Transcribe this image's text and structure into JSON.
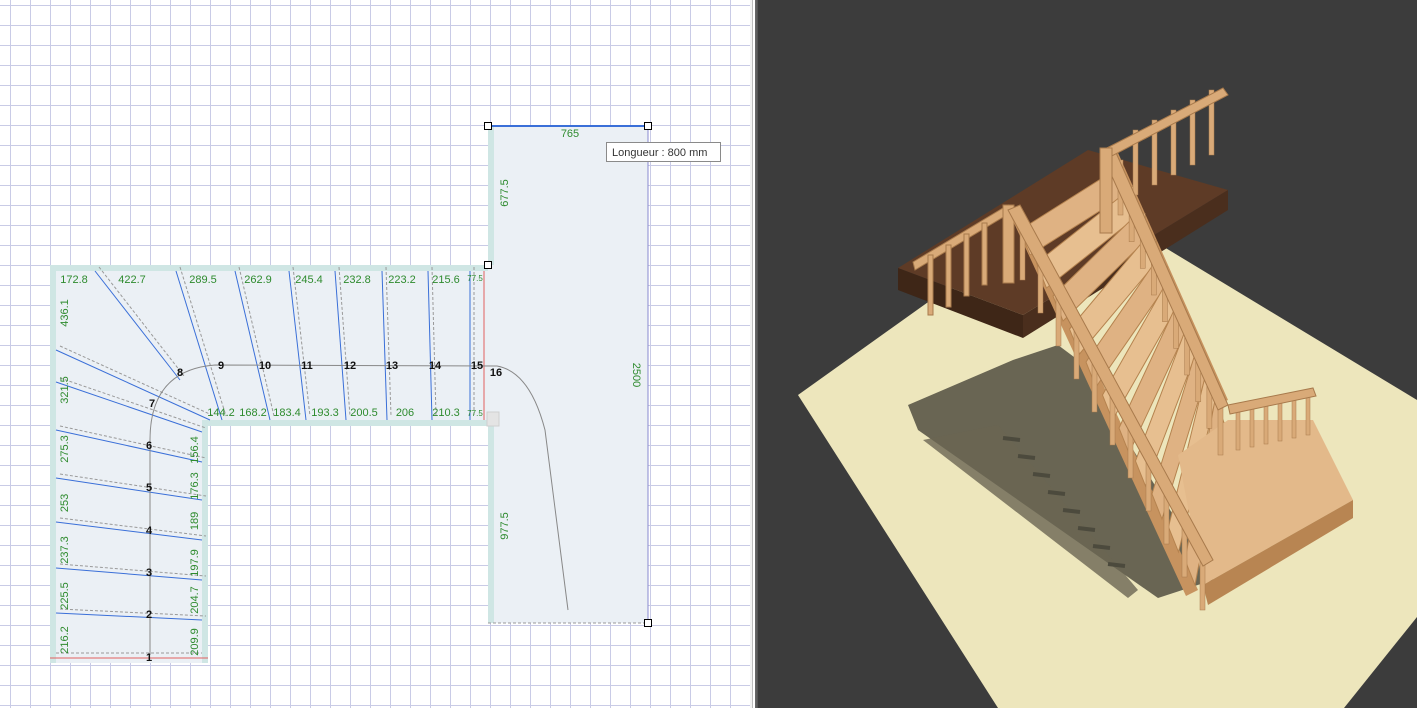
{
  "plan": {
    "tooltip": "Longueur : 800 mm",
    "dims_top": [
      "765"
    ],
    "dims_landing_left": [
      "677.5",
      "977.5"
    ],
    "dims_landing_right": "2500",
    "dims_outer_top": [
      "172.8",
      "422.7",
      "289.5",
      "262.9",
      "245.4",
      "232.8",
      "223.2",
      "215.6",
      "77.5"
    ],
    "dims_inner_top": [
      "144.2",
      "168.2",
      "183.4",
      "193.3",
      "200.5",
      "206",
      "210.3",
      "77.5"
    ],
    "dims_outer_left": [
      "436.1",
      "321.5",
      "275.3",
      "253",
      "237.3",
      "225.5",
      "216.2"
    ],
    "dims_inner_left": [
      "156.4",
      "176.3",
      "189",
      "197.9",
      "204.7",
      "209.9"
    ],
    "step_numbers": [
      "1",
      "2",
      "3",
      "4",
      "5",
      "6",
      "7",
      "8",
      "9",
      "10",
      "11",
      "12",
      "13",
      "14",
      "15",
      "16"
    ]
  },
  "colors": {
    "grid": "#c9cbe6",
    "dim_text": "#2e8b2e",
    "stair_fill": "#ebf0f5",
    "stringer": "#cfe6e4",
    "tread_line": "#3a6fd8",
    "view3d_bg": "#3c3c3c",
    "floor": "#ede6bc",
    "wood": "#d9aa78",
    "landing_wood": "#5e3b26"
  }
}
